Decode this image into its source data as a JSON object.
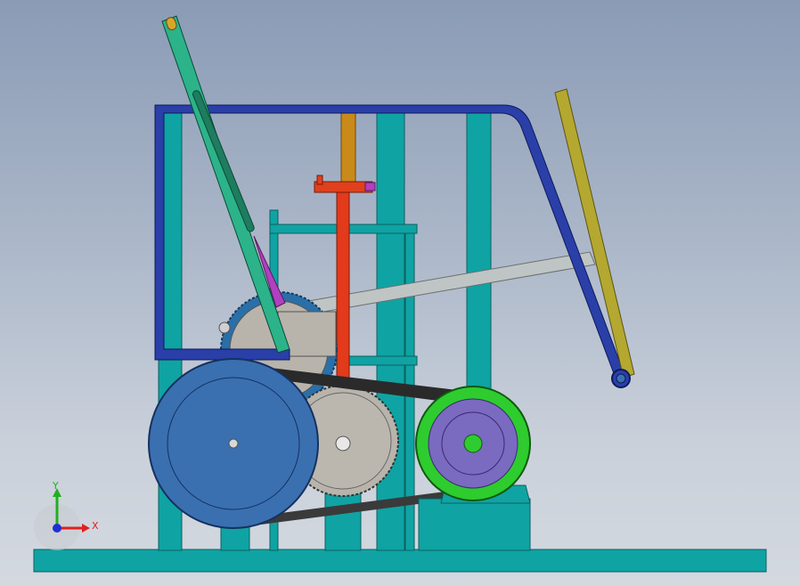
{
  "viewport": {
    "background_top": "#8a9bb6",
    "background_bottom": "#d4d9e0"
  },
  "colors": {
    "frame_teal": "#10a3a3",
    "frame_teal_dark": "#0a6f70",
    "frame_blue": "#2a3fa8",
    "lever_green": "#2cb38a",
    "lever_yellow_tip": "#d9a62a",
    "rod_olive": "#b4a830",
    "rod_orange": "#c98a1a",
    "shaft_red": "#e23a1a",
    "bracket_red": "#e0401c",
    "link_grey": "#bfc5c5",
    "gear_grey": "#b8b4ac",
    "gear_blue": "#2a6fa8",
    "flywheel_blue": "#3a70b0",
    "belt_dark": "#2a2a2a",
    "motor_green": "#2ecc2e",
    "motor_purple": "#7a6ac0",
    "magenta_part": "#b040c0"
  },
  "triad": {
    "x_label": "X",
    "y_label": "Y",
    "x_color": "#e02020",
    "y_color": "#20b020",
    "z_color": "#2030d0"
  },
  "parts": [
    "base-plate",
    "frame",
    "hand-lever",
    "spindle-shaft",
    "upper-gear",
    "lower-gear",
    "flywheel",
    "motor-pulley",
    "drive-belt",
    "connecting-link",
    "rocker-arm"
  ]
}
